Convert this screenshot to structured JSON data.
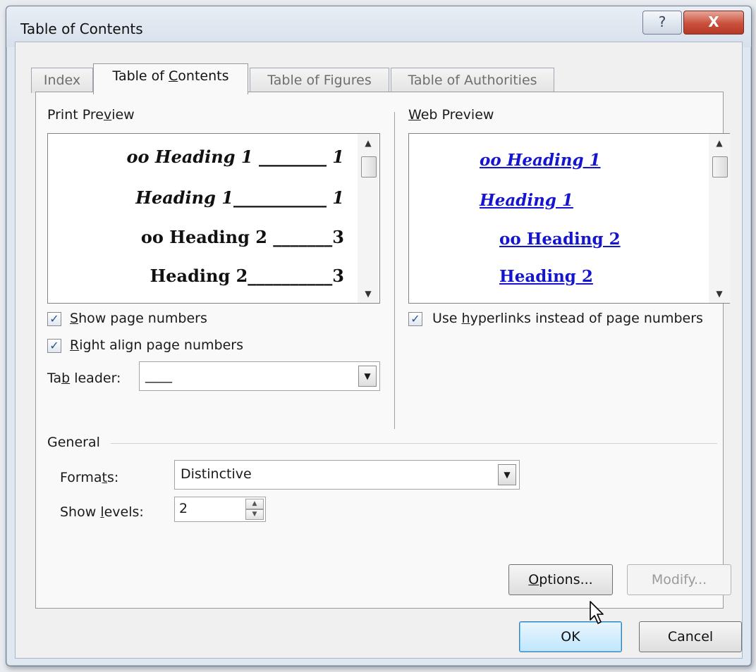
{
  "window": {
    "title": "Table of Contents",
    "help_label": "?",
    "close_label": "X"
  },
  "tabs": [
    {
      "label": "Index"
    },
    {
      "label": "Table of Contents"
    },
    {
      "label": "Table of Figures"
    },
    {
      "label": "Table of Authorities"
    }
  ],
  "print_preview": {
    "label": "Print Preview",
    "lines": [
      {
        "text": "oo Heading 1 ________ 1"
      },
      {
        "text": "Heading 1___________ 1"
      },
      {
        "text": "oo Heading 2 _______3"
      },
      {
        "text": "Heading 2__________3"
      }
    ]
  },
  "web_preview": {
    "label": "Web Preview",
    "lines": [
      {
        "text": "oo Heading 1"
      },
      {
        "text": "Heading 1"
      },
      {
        "text": "oo Heading 2"
      },
      {
        "text": "Heading 2"
      }
    ]
  },
  "options": {
    "show_page_numbers": {
      "label": "Show page numbers",
      "checked": true,
      "mark": "✓"
    },
    "right_align": {
      "label": "Right align page numbers",
      "checked": true,
      "mark": "✓"
    },
    "use_hyperlinks": {
      "label": "Use hyperlinks instead of page numbers",
      "checked": true,
      "mark": "✓"
    },
    "tab_leader": {
      "label": "Tab leader:",
      "value": "____"
    }
  },
  "general": {
    "label": "General",
    "formats": {
      "label": "Formats:",
      "value": "Distinctive"
    },
    "show_levels": {
      "label": "Show levels:",
      "value": "2"
    }
  },
  "buttons": {
    "options": "Options...",
    "modify": "Modify...",
    "ok": "OK",
    "cancel": "Cancel"
  },
  "icons": {
    "dropdown": "chevron-down-icon",
    "scroll_up": "scroll-up-icon",
    "scroll_down": "scroll-down-icon",
    "cursor": "mouse-pointer-icon"
  },
  "colors": {
    "hyperlink": "#1515d0",
    "close_button": "#c9503c",
    "default_button": "#bee6fd"
  }
}
